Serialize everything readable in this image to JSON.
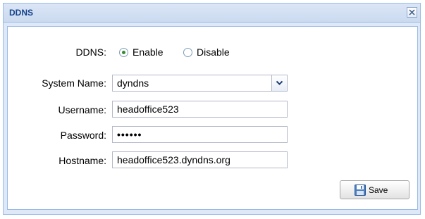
{
  "window": {
    "title": "DDNS",
    "close_icon": "close-icon"
  },
  "form": {
    "ddns_label": "DDNS:",
    "enable_label": "Enable",
    "disable_label": "Disable",
    "selected": "Enable",
    "system_name_label": "System Name:",
    "system_name_value": "dyndns",
    "username_label": "Username:",
    "username_value": "headoffice523",
    "password_label": "Password:",
    "password_value": "••••••",
    "hostname_label": "Hostname:",
    "hostname_value": "headoffice523.dyndns.org"
  },
  "toolbar": {
    "save_label": "Save",
    "save_icon": "floppy-disk-icon"
  },
  "colors": {
    "title_text": "#15428b",
    "border": "#99bbe8",
    "radio_selected": "#3a8a2e"
  }
}
